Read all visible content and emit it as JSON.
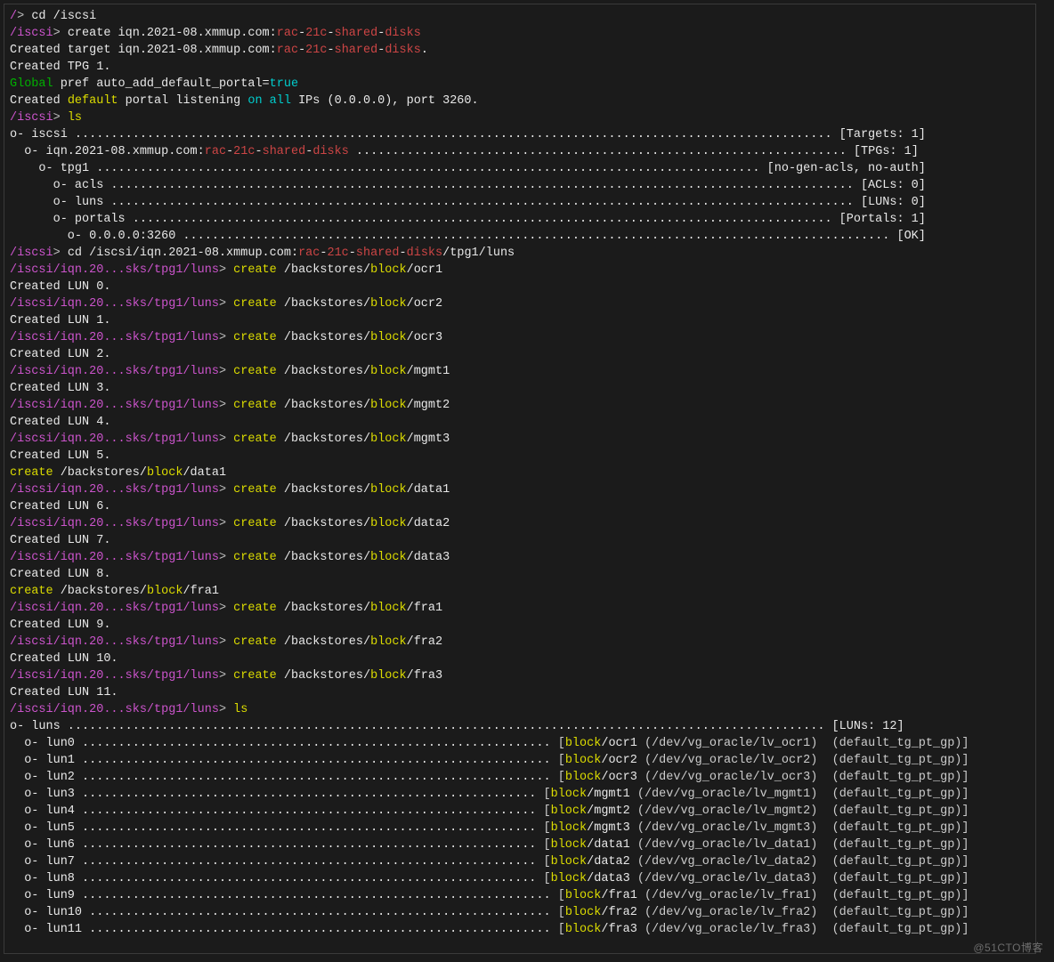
{
  "prompt_root": "/",
  "prompt_iscsi": "/iscsi",
  "prompt_luns": "/iscsi/iqn.20...sks/tpg1/luns",
  "prompt_gt": ">",
  "cmd_cd_iscsi": "cd /iscsi",
  "cmd_create_target_pre": "create iqn.2021-08.xmmup.com:",
  "tgt_mid": "rac-21c-shared-disks",
  "msg_created_target_pre": "Created target iqn.2021-08.xmmup.com:",
  "msg_created_target_post": ".",
  "msg_created_tpg": "Created TPG 1.",
  "msg_global": "Global",
  "msg_global_rest": " pref auto_add_default_portal=",
  "msg_global_true": "true",
  "msg_created_portal1": "Created ",
  "msg_created_portal_def": "default",
  "msg_created_portal2": " portal listening ",
  "msg_on_all": "on all",
  "msg_created_portal3": " IPs (0.0.0.0), port 3260.",
  "cmd_ls": "ls",
  "tree_iscsi": "o- iscsi ......................................................................................................... [Targets: 1]",
  "tree_iqn_pre": "  o- iqn.2021-08.xmmup.com:",
  "tree_iqn_spacer": " ...................................",
  "tree_iqn_dots": "................................. [TPGs: 1]",
  "tree_tpg": "    o- tpg1 ............................................................................................ [no-gen-acls, no-auth]",
  "tree_acls": "      o- acls ....................................................................................................... [ACLs: 0]",
  "tree_luns": "      o- luns ....................................................................................................... [LUNs: 0]",
  "tree_portals": "      o- portals ................................................................................................. [Portals: 1]",
  "tree_portal0": "        o- 0.0.0.0:3260 .................................................................................................. [OK]",
  "cmd_cd_luns_pre": "cd /iscsi/iqn.2021-08.xmmup.com:",
  "cmd_cd_luns_post": "/tpg1/luns",
  "cmd_create": "create",
  "path_bs": " /backstores/",
  "path_block": "block",
  "slash": "/",
  "items": [
    {
      "name": "ocr1",
      "lun": "Created LUN 0.",
      "loose": false
    },
    {
      "name": "ocr2",
      "lun": "Created LUN 1.",
      "loose": false
    },
    {
      "name": "ocr3",
      "lun": "Created LUN 2.",
      "loose": false
    },
    {
      "name": "mgmt1",
      "lun": "Created LUN 3.",
      "loose": false
    },
    {
      "name": "mgmt2",
      "lun": "Created LUN 4.",
      "loose": false
    },
    {
      "name": "mgmt3",
      "lun": "Created LUN 5.",
      "loose": false
    },
    {
      "name": "data1",
      "lun": "Created LUN 6.",
      "loose": true
    },
    {
      "name": "data2",
      "lun": "Created LUN 7.",
      "loose": false
    },
    {
      "name": "data3",
      "lun": "Created LUN 8.",
      "loose": false
    },
    {
      "name": "fra1",
      "lun": "Created LUN 9.",
      "loose": true
    },
    {
      "name": "fra2",
      "lun": "Created LUN 10.",
      "loose": false
    },
    {
      "name": "fra3",
      "lun": "Created LUN 11.",
      "loose": false
    }
  ],
  "ls_tree_luns": "o- luns ......................................................................................................... [LUNs: 12]",
  "lun_rows": [
    {
      "n": "lun0",
      "nm": "ocr1",
      "dev": "/dev/vg_oracle/lv_ocr1"
    },
    {
      "n": "lun1",
      "nm": "ocr2",
      "dev": "/dev/vg_oracle/lv_ocr2"
    },
    {
      "n": "lun2",
      "nm": "ocr3",
      "dev": "/dev/vg_oracle/lv_ocr3"
    },
    {
      "n": "lun3",
      "nm": "mgmt1",
      "dev": "/dev/vg_oracle/lv_mgmt1"
    },
    {
      "n": "lun4",
      "nm": "mgmt2",
      "dev": "/dev/vg_oracle/lv_mgmt2"
    },
    {
      "n": "lun5",
      "nm": "mgmt3",
      "dev": "/dev/vg_oracle/lv_mgmt3"
    },
    {
      "n": "lun6",
      "nm": "data1",
      "dev": "/dev/vg_oracle/lv_data1"
    },
    {
      "n": "lun7",
      "nm": "data2",
      "dev": "/dev/vg_oracle/lv_data2"
    },
    {
      "n": "lun8",
      "nm": "data3",
      "dev": "/dev/vg_oracle/lv_data3"
    },
    {
      "n": "lun9",
      "nm": "fra1",
      "dev": "/dev/vg_oracle/lv_fra1"
    },
    {
      "n": "lun10",
      "nm": "fra2",
      "dev": "/dev/vg_oracle/lv_fra2"
    },
    {
      "n": "lun11",
      "nm": "fra3",
      "dev": "/dev/vg_oracle/lv_fra3"
    }
  ],
  "default_tg": "(default_tg_pt_gp)",
  "watermark": "@51CTO博客"
}
